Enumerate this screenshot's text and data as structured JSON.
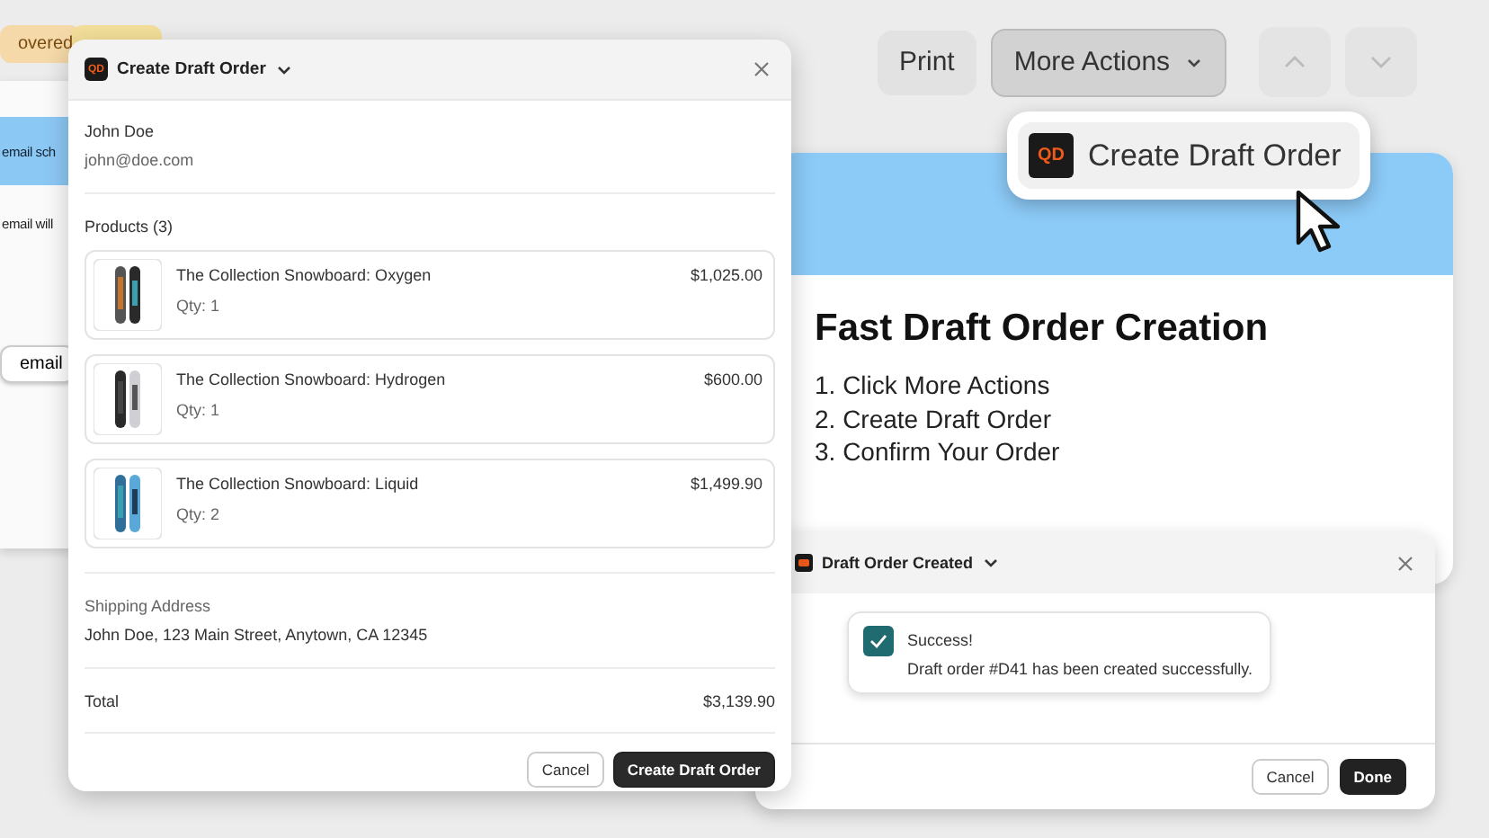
{
  "background_panel": {
    "tag": {
      "label": "overed"
    },
    "banner_text": "email sch",
    "note_text": "email will",
    "button": "email"
  },
  "draft_dialog": {
    "logo": "QD",
    "title": "Create Draft Order",
    "customer_name": "John Doe",
    "customer_email": "john@doe.com",
    "products_heading": "Products (3)",
    "products": [
      {
        "name": "The Collection Snowboard: Oxygen",
        "qty": "Qty: 1",
        "price": "$1,025.00"
      },
      {
        "name": "The Collection Snowboard: Hydrogen",
        "qty": "Qty: 1",
        "price": "$600.00"
      },
      {
        "name": "The Collection Snowboard: Liquid",
        "qty": "Qty: 2",
        "price": "$1,499.90"
      }
    ],
    "shipping_label": "Shipping Address",
    "shipping_address": "John Doe, 123 Main Street, Anytown, CA 12345",
    "total_label": "Total",
    "total": "$3,139.90",
    "cancel": "Cancel",
    "confirm": "Create Draft Order"
  },
  "toolbar": {
    "print": "Print",
    "more_actions": "More Actions",
    "menu_item": {
      "logo": "QD",
      "label": "Create Draft Order"
    }
  },
  "info_card": {
    "title": "Fast Draft Order Creation",
    "steps": [
      "1. Click More Actions",
      "2. Create Draft Order",
      "3. Confirm Your Order"
    ]
  },
  "success_dialog": {
    "title": "Draft Order Created",
    "toast_title": "Success!",
    "toast_message": "Draft order #D41 has been created successfully.",
    "cancel": "Cancel",
    "done": "Done"
  }
}
